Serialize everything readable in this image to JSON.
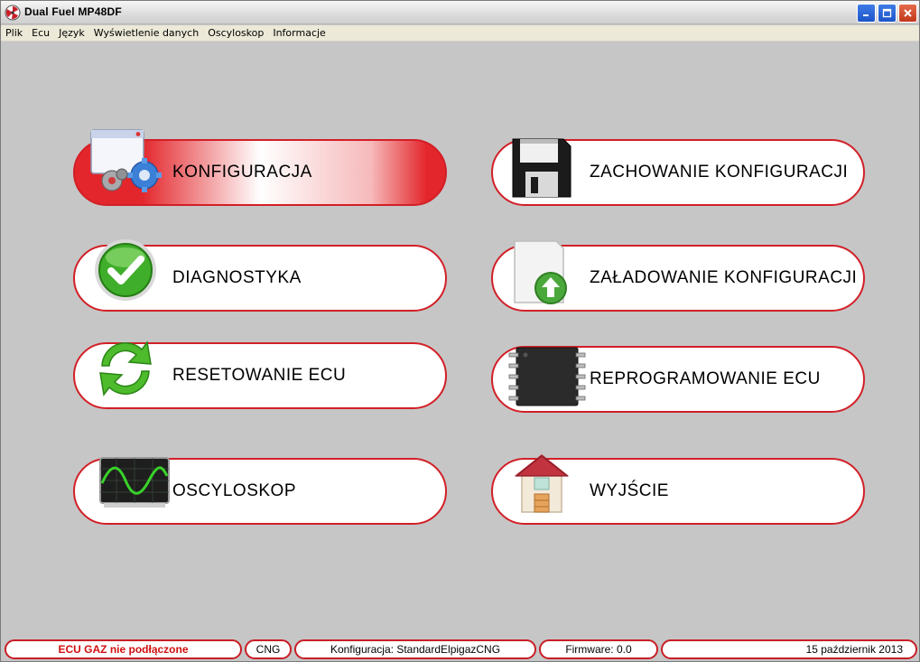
{
  "window": {
    "title": "Dual Fuel MP48DF"
  },
  "menu": [
    "Plik",
    "Ecu",
    "Język",
    "Wyświetlenie danych",
    "Oscyloskop",
    "Informacje"
  ],
  "buttons": {
    "konfiguracja": "KONFIGURACJA",
    "zachowanie": "ZACHOWANIE KONFIGURACJI",
    "diagnostyka": "DIAGNOSTYKA",
    "zaladowanie": "ZAŁADOWANIE KONFIGURACJI",
    "resetowanie": "RESETOWANIE ECU",
    "reprogramowanie": "REPROGRAMOWANIE ECU",
    "oscyloskop": "OSCYLOSKOP",
    "wyjscie": "WYJŚCIE"
  },
  "status": {
    "connection": "ECU GAZ nie podłączone",
    "fuel": "CNG",
    "config": "Konfiguracja: StandardElpigazCNG",
    "firmware": "Firmware: 0.0",
    "date": "15 październik 2013"
  },
  "colors": {
    "accent_red": "#d21f27",
    "background": "#c6c6c6",
    "status_error": "#d01010"
  },
  "icons": {
    "app": "fan-icon",
    "konfiguracja": "settings-gears-icon",
    "zachowanie": "floppy-disk-icon",
    "diagnostyka": "checkmark-icon",
    "zaladowanie": "upload-document-icon",
    "resetowanie": "refresh-arrows-icon",
    "reprogramowanie": "microchip-icon",
    "oscyloskop": "oscilloscope-icon",
    "wyjscie": "house-icon"
  }
}
